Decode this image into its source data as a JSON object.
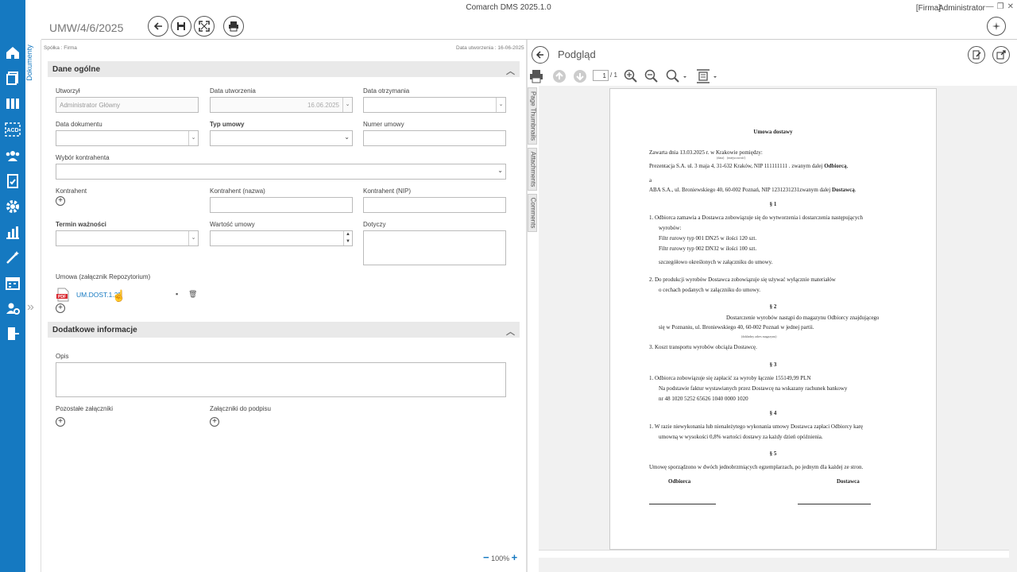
{
  "app": {
    "title": "Comarch DMS 2025.1.0",
    "firma": "[Firma]",
    "user": "Administrator"
  },
  "nav": [
    "home-icon",
    "documents-icon",
    "library-icon",
    "acd-icon",
    "users-icon",
    "reports-icon",
    "settings-icon",
    "analytics-icon",
    "wand-icon",
    "calendar-icon",
    "user-settings-icon",
    "logout-icon"
  ],
  "doc": {
    "number": "UMW/4/6/2025",
    "spolka": "Spółka : Firma",
    "data_utworzenia": "Data utworzenia : 16-06-2025",
    "vtab": "Dokumenty"
  },
  "sections": {
    "general": "Dane ogólne",
    "additional": "Dodatkowe informacje"
  },
  "fields": {
    "utworzyl": {
      "label": "Utworzył",
      "value": "Administrator Główny"
    },
    "data_utworzenia": {
      "label": "Data utworzenia",
      "value": "16.06.2025"
    },
    "data_otrzymania": {
      "label": "Data otrzymania",
      "value": ""
    },
    "data_dokumentu": {
      "label": "Data dokumentu",
      "value": ""
    },
    "typ_umowy": {
      "label": "Typ umowy",
      "value": ""
    },
    "numer_umowy": {
      "label": "Numer umowy",
      "value": ""
    },
    "wybor": {
      "label": "Wybór kontrahenta",
      "value": ""
    },
    "kontrahent": {
      "label": "Kontrahent"
    },
    "kontrahent_nazwa": {
      "label": "Kontrahent (nazwa)",
      "value": ""
    },
    "kontrahent_nip": {
      "label": "Kontrahent (NIP)",
      "value": ""
    },
    "termin": {
      "label": "Termin ważności",
      "value": ""
    },
    "wartosc": {
      "label": "Wartość umowy",
      "value": ""
    },
    "dotyczy": {
      "label": "Dotyczy",
      "value": ""
    },
    "umowa": {
      "label": "Umowa (załącznik Repozytorium)",
      "file": "UM.DOST.1.25"
    },
    "opis": {
      "label": "Opis",
      "value": ""
    },
    "pozostale": {
      "label": "Pozostałe załączniki"
    },
    "do_podpisu": {
      "label": "Załączniki do podpisu"
    }
  },
  "zoom": "100%",
  "preview": {
    "title": "Podgląd",
    "page": "1",
    "pages": "/ 1",
    "side_tabs": [
      "Page Thumbnails",
      "Attachments",
      "Comments"
    ],
    "doc": {
      "title": "Umowa dostawy",
      "l1": "Zawarta dnia 13.03.2025 r. w Krakowie pomiędzy:",
      "l1s": "(data)",
      "l1s2": "(miejscowość)",
      "l2a": "Prezentacja S.A. ul. 3 maja 4, 31-632 Kraków, NIP 111111111 . zwanym dalej ",
      "l2b": "Odbiorcą",
      "l3": "a",
      "l4a": "ABA S.A., ul. Broniewskiego 40, 60-002 Poznań, NIP 1231231231zwanym dalej ",
      "l4b": "Dostawcą",
      "s1": "§ 1",
      "p1": "1.       Odbiorca zamawia a Dostawca zobowiązuje się do wytworzenia i dostarczenia następujących",
      "p1b": "wyrobów:",
      "p1c": "Filtr rurowy typ 001 DN25 w ilości 120 szt.",
      "p1d": "Filtr rurowy typ 002 DN32 w ilości 100 szt.",
      "p1e": "szczegółowo określonych w załączniku do umowy.",
      "p2": "2.       Do produkcji wyrobów Dostawca zobowiązuje się używać wyłącznie materiałów",
      "p2b": "o cechach podanych w załączniku do umowy.",
      "s2": "§ 2",
      "p3": "Dostarczenie wyrobów nastąpi do magazynu Odbiorcy znajdującego",
      "p3b": "się w      Poznaniu, ul. Broniewskiego 40, 60-002 Poznań  w jednej partii.",
      "p3s": "(dokładny adres magazynu)",
      "p4": "3.       Koszt transportu wyrobów obciąża Dostawcę.",
      "s3": "§ 3",
      "p5": "1.       Odbiorca zobowiązuje się zapłacić za wyroby łącznie 155149,99 PLN",
      "p5b": "Na podstawie faktur wystawianych przez Dostawcę na wskazany rachunek bankowy",
      "p5c": "nr 48 1020 5252 65626 1040 0000 1020",
      "s4": "§ 4",
      "p6": "1.   W razie niewykonania lub nienależytego wykonania umowy Dostawca zapłaci Odbiorcy karę",
      "p6b": "umowną w wysokości 0,8% wartości dostawy za każdy dzień opóźnienia.",
      "s5": "§ 5",
      "p7": "Umowę sporządzono w dwóch jednobrzmiących egzemplarzach, po jednym dla każdej ze stron.",
      "sig1": "Odbiorca",
      "sig2": "Dostawca"
    }
  }
}
